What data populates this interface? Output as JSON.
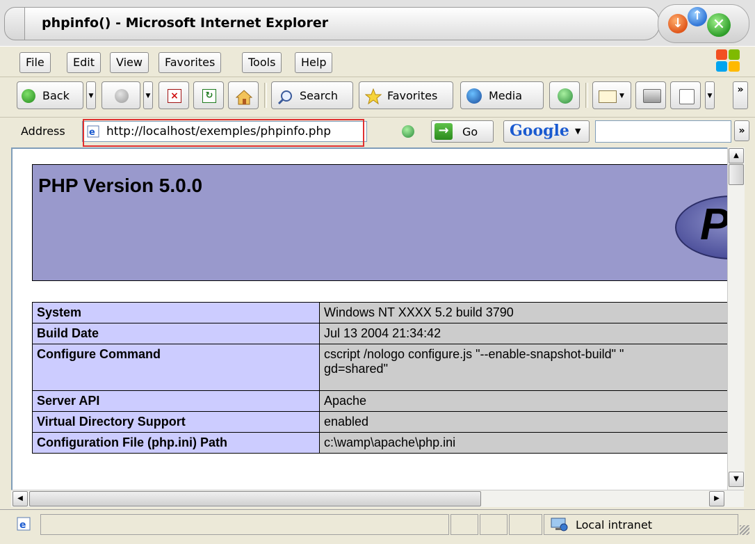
{
  "window": {
    "title": "phpinfo() - Microsoft Internet Explorer"
  },
  "menu": {
    "items": [
      {
        "label": "File",
        "accel": "F"
      },
      {
        "label": "Edit",
        "accel": "E"
      },
      {
        "label": "View",
        "accel": "V"
      },
      {
        "label": "Favorites",
        "accel": "a"
      },
      {
        "label": "Tools",
        "accel": "T"
      },
      {
        "label": "Help",
        "accel": "H"
      }
    ]
  },
  "toolbar": {
    "back_label": "Back",
    "search_label": "Search",
    "favorites_label": "Favorites",
    "media_label": "Media",
    "overflow_label": "»"
  },
  "address": {
    "label": "Address",
    "url": "http://localhost/exemples/phpinfo.php",
    "go_label": "Go",
    "google_label": "Google"
  },
  "page": {
    "heading": "PHP Version 5.0.0",
    "logo_letter": "P",
    "rows": [
      {
        "key": "System",
        "value": "Windows NT XXXX 5.2 build 3790"
      },
      {
        "key": "Build Date",
        "value": "Jul 13 2004 21:34:42"
      },
      {
        "key": "Configure Command",
        "value": "cscript /nologo configure.js \"--enable-snapshot-build\" \"\n gd=shared\""
      },
      {
        "key": "Server API",
        "value": "Apache"
      },
      {
        "key": "Virtual Directory Support",
        "value": "enabled"
      },
      {
        "key": "Configuration File (php.ini) Path",
        "value": "c:\\wamp\\apache\\php.ini"
      }
    ]
  },
  "status": {
    "zone": "Local intranet"
  },
  "colors": {
    "php_header_bg": "#9999cc",
    "key_cell_bg": "#ccccff",
    "value_cell_bg": "#cccccc",
    "address_highlight": "#e03030"
  }
}
